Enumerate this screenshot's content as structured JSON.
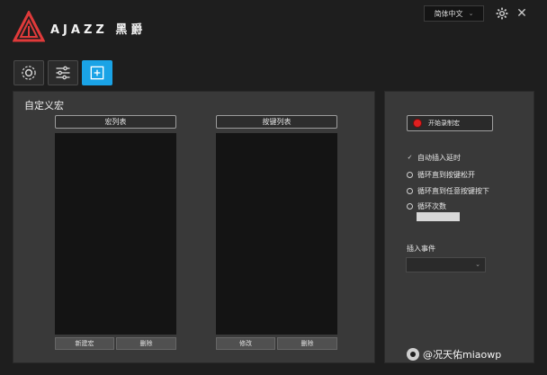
{
  "header": {
    "brand_text": "AJAZZ 黑爵",
    "language_select": "简体中文"
  },
  "tabs": [
    {
      "name": "settings",
      "icon": "gear-icon"
    },
    {
      "name": "adjust",
      "icon": "sliders-icon"
    },
    {
      "name": "macro",
      "icon": "plus-square-icon",
      "active": true
    }
  ],
  "macro_panel": {
    "title": "自定义宏",
    "macro_list_header": "宏列表",
    "key_list_header": "按键列表",
    "new_macro_button": "新建宏",
    "delete_macro_button": "删除",
    "modify_key_button": "修改",
    "delete_key_button": "删除"
  },
  "options_panel": {
    "record_button": "开始录制宏",
    "auto_insert_delay": "自动插入延时",
    "auto_insert_delay_checked": true,
    "loop_until_release": "循环直到按键松开",
    "loop_until_any_key": "循环直到任意按键按下",
    "loop_count": "循环次数",
    "loop_count_value": "",
    "insert_event_label": "插入事件",
    "insert_event_value": ""
  },
  "watermark": "@况天佑miaowp",
  "colors": {
    "accent": "#1aa3e6",
    "record": "#e02020",
    "logo": "#e03a3a"
  }
}
